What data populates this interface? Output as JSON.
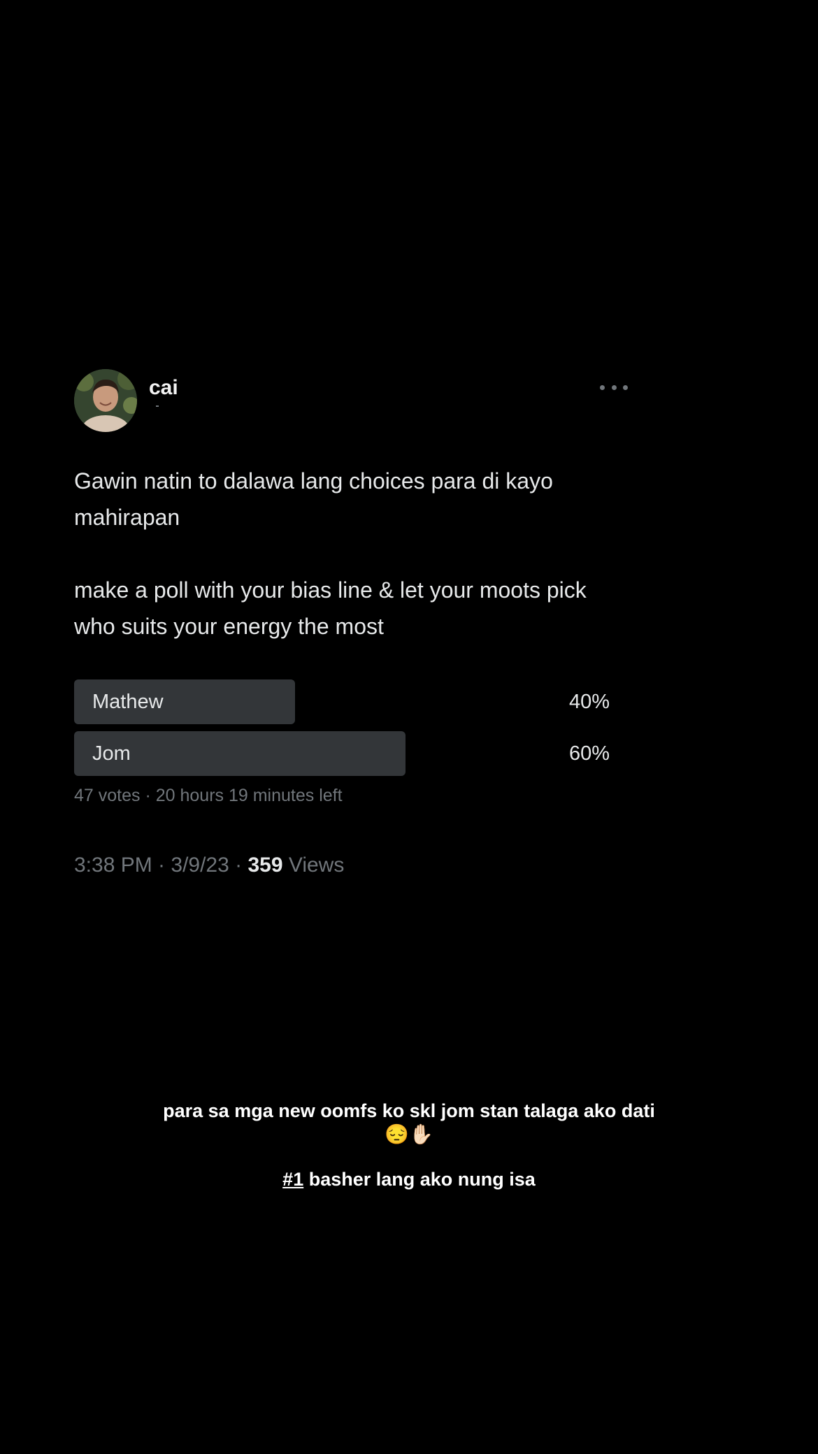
{
  "tweet": {
    "author": {
      "display_name": "cai",
      "avatar": "avatar-photo"
    },
    "more_icon": "more-horizontal-icon",
    "text": "Gawin natin to dalawa lang choices para di kayo mahirapan\n\nmake a poll with your bias line & let your moots pick who suits your energy the most",
    "poll": {
      "options": [
        {
          "label": "Mathew",
          "percent_label": "40%",
          "percent": 40
        },
        {
          "label": "Jom",
          "percent_label": "60%",
          "percent": 60
        }
      ],
      "meta": "47 votes · 20 hours 19 minutes left"
    },
    "meta": {
      "time_date": "3:38 PM · 3/9/23 · ",
      "views_count": "359",
      "views_label": " Views"
    }
  },
  "caption": {
    "line1": "para sa mga new oomfs ko skl jom stan talaga ako dati",
    "emojis": "😔✋🏻",
    "hashtag": "#1",
    "line2_rest": " basher lang ako nung isa"
  },
  "colors": {
    "background": "#000000",
    "poll_bar": "#333639",
    "secondary_text": "#71767b"
  }
}
